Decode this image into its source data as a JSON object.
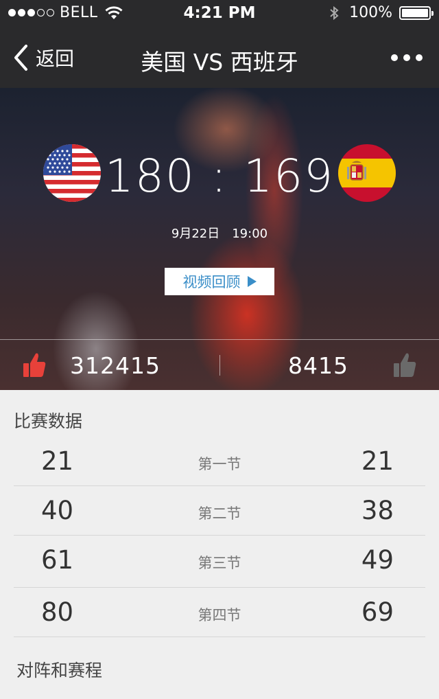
{
  "status_bar": {
    "carrier": "BELL",
    "signal_dots_filled": 3,
    "signal_dots_total": 5,
    "time": "4:21 PM",
    "battery": "100%"
  },
  "nav": {
    "back_label": "返回",
    "title": "美国 VS 西班牙"
  },
  "match": {
    "home_team_flag": "usa-flag-icon",
    "away_team_flag": "spain-flag-icon",
    "home_score": "180",
    "separator": ":",
    "away_score": "169",
    "date": "9月22日",
    "time": "19:00",
    "video_button_label": "视频回顾",
    "likes": "312415",
    "dislikes": "8415",
    "like_color": "#e8413a"
  },
  "stats": {
    "title": "比赛数据",
    "rows": [
      {
        "home": "21",
        "label": "第一节",
        "away": "21"
      },
      {
        "home": "40",
        "label": "第二节",
        "away": "38"
      },
      {
        "home": "61",
        "label": "第三节",
        "away": "49"
      },
      {
        "home": "80",
        "label": "第四节",
        "away": "69"
      }
    ]
  },
  "schedule": {
    "title": "对阵和赛程"
  }
}
